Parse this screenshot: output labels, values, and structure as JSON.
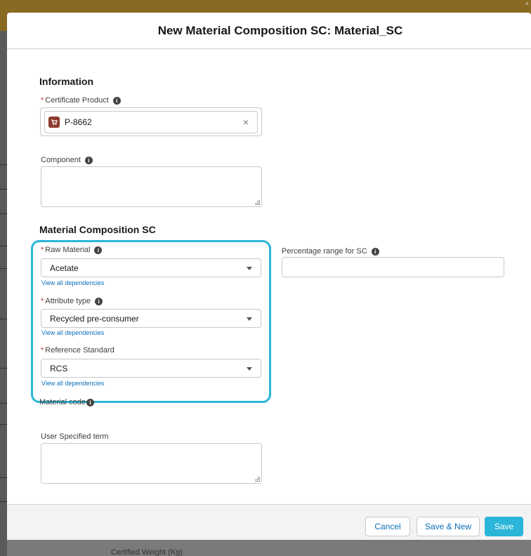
{
  "modal": {
    "title": "New Material Composition SC: Material_SC"
  },
  "sections": {
    "information": "Information",
    "material_composition": "Material Composition SC"
  },
  "fields": {
    "certificate_product": {
      "label": "Certificate Product",
      "required": true,
      "value": "P-8662",
      "icon": "product-cart-icon"
    },
    "component": {
      "label": "Component",
      "value": ""
    },
    "raw_material": {
      "label": "Raw Material",
      "required": true,
      "value": "Acetate",
      "link": "View all dependencies"
    },
    "attribute_type": {
      "label": "Attribute type",
      "required": true,
      "value": "Recycled pre-consumer",
      "link": "View all dependencies"
    },
    "reference_standard": {
      "label": "Reference Standard",
      "required": true,
      "value": "RCS",
      "link": "View all dependencies"
    },
    "percentage_range": {
      "label": "Percentage range for SC",
      "value": ""
    },
    "material_code": {
      "label": "Material code"
    },
    "user_specified_term": {
      "label": "User Specified term",
      "value": ""
    }
  },
  "footer": {
    "cancel": "Cancel",
    "save_new": "Save & New",
    "save": "Save"
  },
  "background": {
    "partial_text": "Certified Weight (Kg)"
  },
  "colors": {
    "accent": "#2bb5d8",
    "link": "#0b6fb8",
    "required": "#c23934",
    "product_icon": "#8c3a2e",
    "backdrop_header": "#8a6a22"
  }
}
